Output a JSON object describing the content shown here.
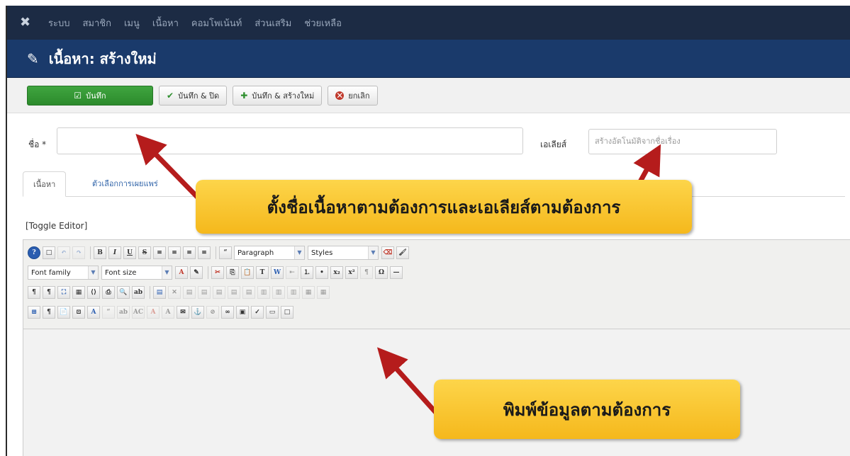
{
  "topnav": {
    "items": [
      "ระบบ",
      "สมาชิก",
      "เมนู",
      "เนื้อหา",
      "คอมโพเน้นท์",
      "ส่วนเสริม",
      "ช่วยเหลือ"
    ]
  },
  "titlebar": {
    "title": "เนื้อหา: สร้างใหม่"
  },
  "toolbar": {
    "save_label": "บันทึก",
    "save_close_label": "บันทึก & ปิด",
    "save_new_label": "บันทึก & สร้างใหม่",
    "cancel_label": "ยกเลิก"
  },
  "form": {
    "title_label": "ชื่อ *",
    "title_value": "",
    "alias_label": "เอเลียส์",
    "alias_placeholder": "สร้างอัตโนมัติจากชื่อเรื่อง"
  },
  "tabs": [
    "เนื้อหา",
    "ตัวเลือกการเผยแพร่"
  ],
  "editor": {
    "toggle_label": "[Toggle Editor]",
    "format_select": "Paragraph",
    "styles_select": "Styles",
    "font_family_select": "Font family",
    "font_size_select": "Font size"
  },
  "callouts": {
    "title_hint": "ตั้งชื่อเนื้อหาตามต้องการและเอเลียส์ตามต้องการ",
    "body_hint": "พิมพ์ข้อมูลตามต้องการ"
  },
  "colors": {
    "topnav_bg": "#1c2b44",
    "titlebar_bg": "#1a3a6b",
    "save_green": "#2f8f2f",
    "callout_yellow": "#f8c42a",
    "arrow_red": "#b51c1c"
  }
}
